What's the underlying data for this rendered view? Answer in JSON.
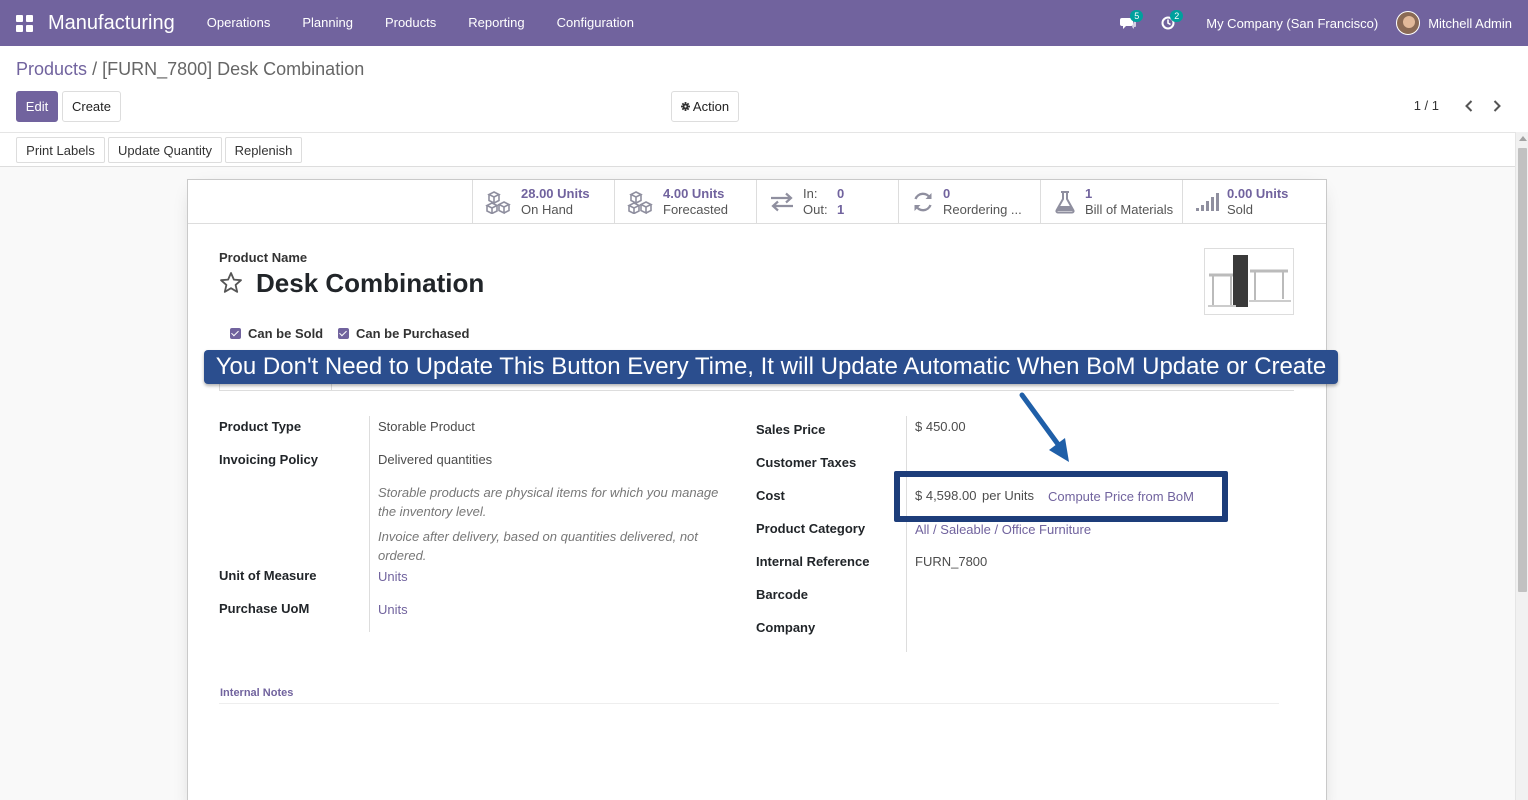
{
  "navbar": {
    "app_name": "Manufacturing",
    "menu": [
      "Operations",
      "Planning",
      "Products",
      "Reporting",
      "Configuration"
    ],
    "messages_badge": "5",
    "activities_badge": "2",
    "company": "My Company (San Francisco)",
    "user": "Mitchell Admin",
    "bg_color": "#71639e"
  },
  "breadcrumb": {
    "parent": "Products",
    "separator": "/",
    "current": "[FURN_7800] Desk Combination"
  },
  "control": {
    "edit_label": "Edit",
    "create_label": "Create",
    "action_label": "Action",
    "pager": "1 / 1"
  },
  "status_buttons": [
    "Print Labels",
    "Update Quantity",
    "Replenish"
  ],
  "smart_buttons": {
    "on_hand_value": "28.00 Units",
    "on_hand_label": "On Hand",
    "forecast_value": "4.00 Units",
    "forecast_label": "Forecasted",
    "in_label": "In:",
    "in_value": "0",
    "out_label": "Out:",
    "out_value": "1",
    "reorder_value": "0",
    "reorder_label": "Reordering ...",
    "bom_value": "1",
    "bom_label": "Bill of Materials",
    "sold_value": "0.00 Units",
    "sold_label": "Sold"
  },
  "form": {
    "name_label": "Product Name",
    "name": "Desk Combination",
    "can_be_sold": "Can be Sold",
    "can_be_purchased": "Can be Purchased",
    "product_type_label": "Product Type",
    "product_type": "Storable Product",
    "invoicing_policy_label": "Invoicing Policy",
    "invoicing_policy": "Delivered quantities",
    "help_storable": "Storable products are physical items for which you manage the inventory level.",
    "help_invoice": "Invoice after delivery, based on quantities delivered, not ordered.",
    "uom_label": "Unit of Measure",
    "uom": "Units",
    "purchase_uom_label": "Purchase UoM",
    "purchase_uom": "Units",
    "sales_price_label": "Sales Price",
    "sales_price": "$ 450.00",
    "customer_taxes_label": "Customer Taxes",
    "cost_label": "Cost",
    "cost": "$ 4,598.00",
    "cost_unit": "per Units",
    "compute_bom": "Compute Price from BoM",
    "category_label": "Product Category",
    "category": "All / Saleable / Office Furniture",
    "internal_ref_label": "Internal Reference",
    "internal_ref": "FURN_7800",
    "barcode_label": "Barcode",
    "company_label": "Company",
    "internal_notes_label": "Internal Notes"
  },
  "annotation": {
    "banner": "You Don't Need to Update This Button Every Time, It will Update Automatic When BoM Update or Create",
    "color": "#2b4e8e"
  }
}
